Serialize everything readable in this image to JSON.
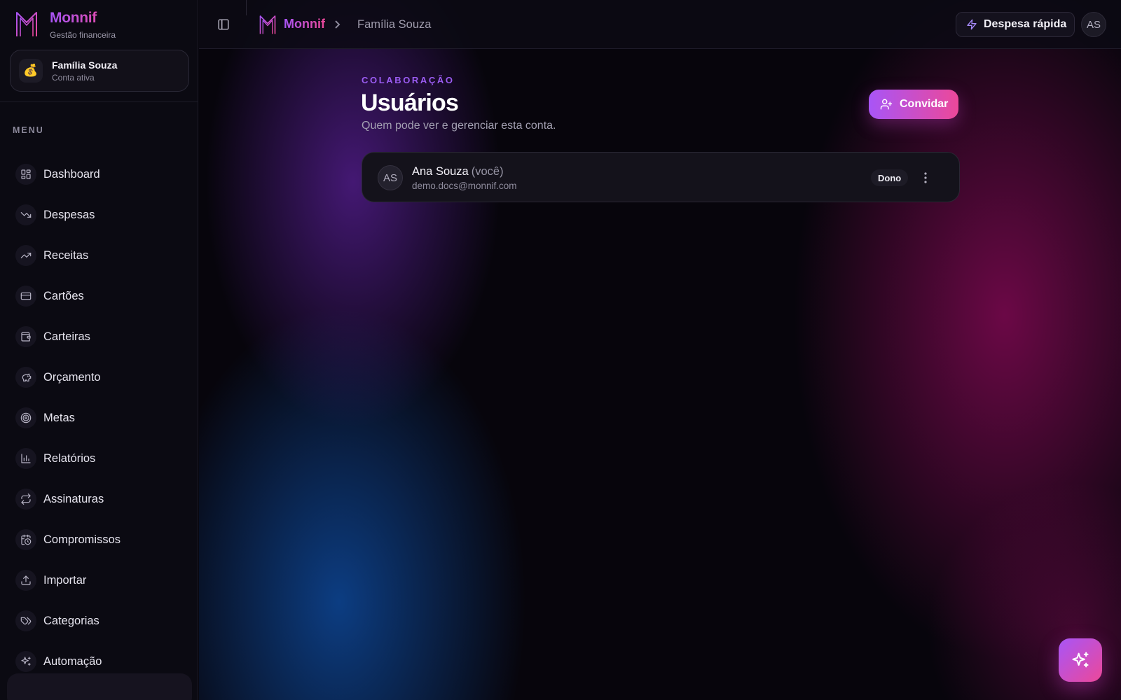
{
  "colors": {
    "accent_purple": "#a855f7",
    "accent_pink": "#ec4899",
    "sidebar_bg": "#0b0a12"
  },
  "brand": {
    "name": "Monnif",
    "subtitle": "Gestão financeira",
    "logo_icon": "monnif-m-logo-icon"
  },
  "account": {
    "name": "Família Souza",
    "status": "Conta ativa",
    "emoji": "💰"
  },
  "sidebar": {
    "menu_heading": "MENU",
    "items": [
      {
        "label": "Dashboard",
        "icon": "dashboard-icon"
      },
      {
        "label": "Despesas",
        "icon": "trending-down-icon"
      },
      {
        "label": "Receitas",
        "icon": "trending-up-icon"
      },
      {
        "label": "Cartões",
        "icon": "credit-card-icon"
      },
      {
        "label": "Carteiras",
        "icon": "wallet-icon"
      },
      {
        "label": "Orçamento",
        "icon": "piggy-bank-icon"
      },
      {
        "label": "Metas",
        "icon": "target-icon"
      },
      {
        "label": "Relatórios",
        "icon": "bar-chart-icon"
      },
      {
        "label": "Assinaturas",
        "icon": "repeat-icon"
      },
      {
        "label": "Compromissos",
        "icon": "calendar-clock-icon"
      },
      {
        "label": "Importar",
        "icon": "upload-icon"
      },
      {
        "label": "Categorias",
        "icon": "tags-icon"
      },
      {
        "label": "Automação",
        "icon": "sparkles-icon"
      }
    ]
  },
  "topbar": {
    "breadcrumb_brand": "Monnif",
    "breadcrumb_page": "Família Souza",
    "quick_expense_label": "Despesa rápida",
    "avatar_initials": "AS"
  },
  "page": {
    "section_label": "COLABORAÇÃO",
    "title": "Usuários",
    "subtitle": "Quem pode ver e gerenciar esta conta.",
    "invite_label": "Convidar"
  },
  "users": [
    {
      "initials": "AS",
      "name": "Ana Souza",
      "you_tag": "(você)",
      "email": "demo.docs@monnif.com",
      "role": "Dono"
    }
  ]
}
